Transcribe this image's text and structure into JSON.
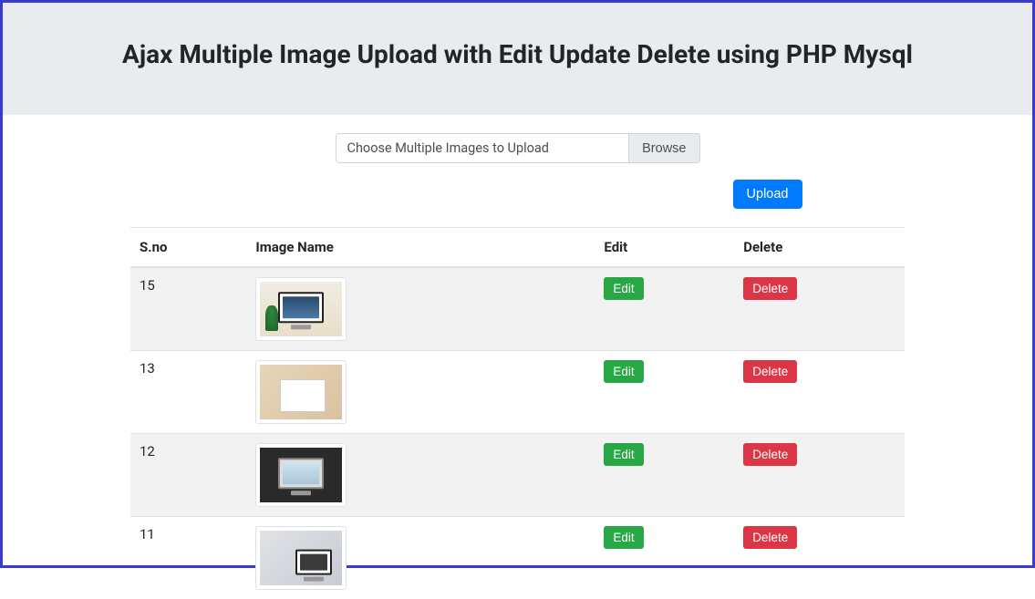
{
  "header": {
    "title": "Ajax Multiple Image Upload with Edit Update Delete using PHP Mysql"
  },
  "fileInput": {
    "placeholder": "Choose Multiple Images to Upload",
    "browseLabel": "Browse"
  },
  "buttons": {
    "upload": "Upload",
    "edit": "Edit",
    "delete": "Delete"
  },
  "table": {
    "headers": {
      "sno": "S.no",
      "imageName": "Image Name",
      "edit": "Edit",
      "delete": "Delete"
    },
    "rows": [
      {
        "sno": "15",
        "thumbClass": "thumb-15"
      },
      {
        "sno": "13",
        "thumbClass": "thumb-13"
      },
      {
        "sno": "12",
        "thumbClass": "thumb-12"
      },
      {
        "sno": "11",
        "thumbClass": "thumb-11"
      }
    ]
  }
}
